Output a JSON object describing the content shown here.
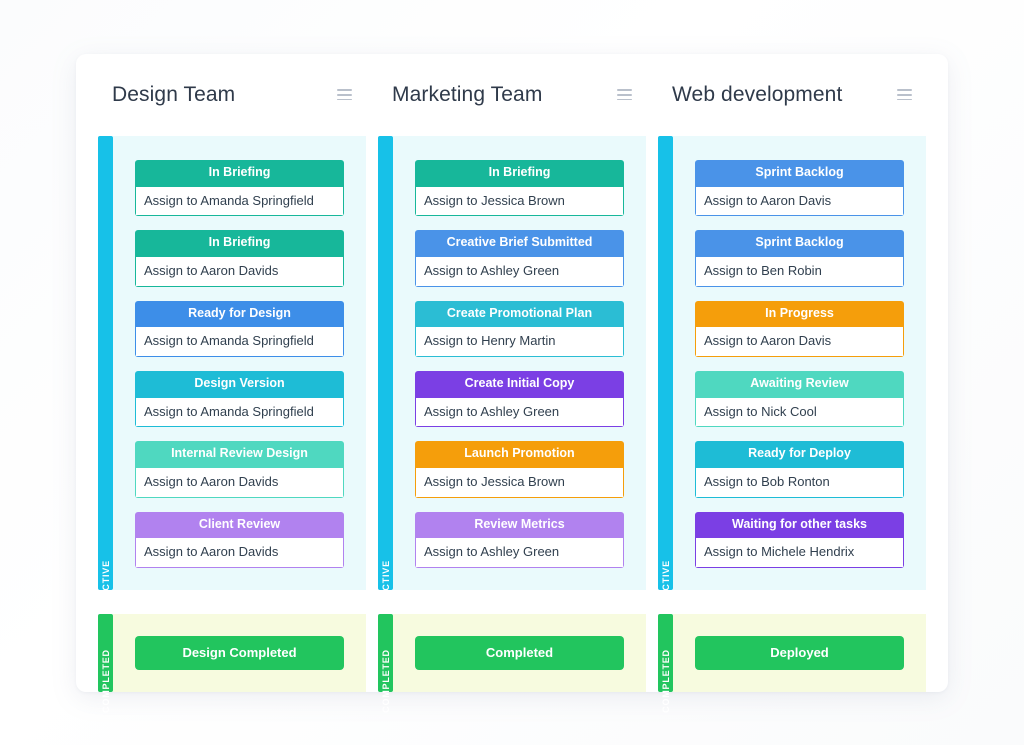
{
  "board": {
    "active_lane_label": "ACTIVE",
    "completed_lane_label": "COMPLETED",
    "active_bar_color": "#17c1e8",
    "completed_bar_color": "#22c55e",
    "active_lane_bg": "#eafafc",
    "completed_lane_bg": "#f7fbdf",
    "panel_bg": "#ffffff",
    "page_bg": "#fdfdfe",
    "menu_icon": "hamburger-menu-icon"
  },
  "columns": [
    {
      "title": "Design Team",
      "menu_icon": "hamburger-menu-icon",
      "cards": [
        {
          "status": "In Briefing",
          "assignee": "Assign to Amanda Springfield",
          "color": "#17b79a"
        },
        {
          "status": "In Briefing",
          "assignee": "Assign to Aaron Davids",
          "color": "#17b79a"
        },
        {
          "status": "Ready for Design",
          "assignee": "Assign to Amanda Springfield",
          "color": "#3d8ee8"
        },
        {
          "status": "Design Version",
          "assignee": "Assign to Amanda Springfield",
          "color": "#1ebcd6"
        },
        {
          "status": "Internal Review Design",
          "assignee": "Assign to Aaron Davids",
          "color": "#4fd8c0"
        },
        {
          "status": "Client Review",
          "assignee": "Assign to Aaron Davids",
          "color": "#b182ef"
        }
      ],
      "completed": {
        "label": "Design Completed",
        "color": "#22c55e"
      }
    },
    {
      "title": "Marketing Team",
      "menu_icon": "hamburger-menu-icon",
      "cards": [
        {
          "status": "In Briefing",
          "assignee": "Assign to Jessica Brown",
          "color": "#17b79a"
        },
        {
          "status": "Creative Brief Submitted",
          "assignee": "Assign to Ashley Green",
          "color": "#4a93e8"
        },
        {
          "status": "Create Promotional Plan",
          "assignee": "Assign to Henry Martin",
          "color": "#2bbdd4"
        },
        {
          "status": "Create Initial Copy",
          "assignee": "Assign to Ashley Green",
          "color": "#7b3fe4"
        },
        {
          "status": "Launch Promotion",
          "assignee": "Assign to Jessica Brown",
          "color": "#f59e0b"
        },
        {
          "status": "Review Metrics",
          "assignee": "Assign to Ashley Green",
          "color": "#b182ef"
        }
      ],
      "completed": {
        "label": "Completed",
        "color": "#22c55e"
      }
    },
    {
      "title": "Web development",
      "menu_icon": "hamburger-menu-icon",
      "cards": [
        {
          "status": "Sprint Backlog",
          "assignee": "Assign to Aaron Davis",
          "color": "#4a93e8"
        },
        {
          "status": "Sprint Backlog",
          "assignee": "Assign to Ben Robin",
          "color": "#4a93e8"
        },
        {
          "status": "In Progress",
          "assignee": "Assign to Aaron Davis",
          "color": "#f59e0b"
        },
        {
          "status": "Awaiting Review",
          "assignee": "Assign to Nick Cool",
          "color": "#4fd8c0"
        },
        {
          "status": "Ready for Deploy",
          "assignee": "Assign to Bob Ronton",
          "color": "#1ebcd6"
        },
        {
          "status": "Waiting for other tasks",
          "assignee": "Assign to Michele Hendrix",
          "color": "#7b3fe4"
        }
      ],
      "completed": {
        "label": "Deployed",
        "color": "#22c55e"
      }
    }
  ]
}
